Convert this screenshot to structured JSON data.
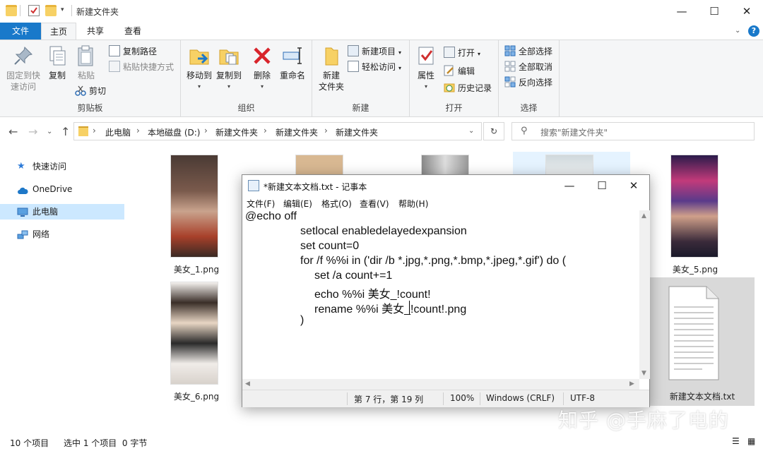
{
  "window": {
    "title": "新建文件夹",
    "minimize": "—",
    "maximize": "☐",
    "close": "✕"
  },
  "ribbon_tabs": [
    "文件",
    "主页",
    "共享",
    "查看"
  ],
  "ribbon": {
    "clipboard": {
      "label": "剪贴板",
      "pin": "固定到快速访问",
      "pin_l1": "固定到快",
      "pin_l2": "速访问",
      "copy": "复制",
      "paste": "粘贴",
      "copy_path": "复制路径",
      "paste_shortcut": "粘贴快捷方式",
      "cut": "剪切"
    },
    "organize": {
      "label": "组织",
      "move_to": "移动到",
      "copy_to": "复制到",
      "delete": "删除",
      "rename": "重命名"
    },
    "new": {
      "label": "新建",
      "new_folder_l1": "新建",
      "new_folder_l2": "文件夹",
      "new_item": "新建项目",
      "easy_access": "轻松访问"
    },
    "open": {
      "label": "打开",
      "properties": "属性",
      "open": "打开",
      "edit": "编辑",
      "history": "历史记录"
    },
    "select": {
      "label": "选择",
      "select_all": "全部选择",
      "select_none": "全部取消",
      "invert": "反向选择"
    }
  },
  "address": {
    "crumbs": [
      "此电脑",
      "本地磁盘 (D:)",
      "新建文件夹",
      "新建文件夹",
      "新建文件夹"
    ],
    "search_placeholder": "搜索\"新建文件夹\""
  },
  "nav": [
    "快速访问",
    "OneDrive",
    "此电脑",
    "网络"
  ],
  "files": {
    "f1": "美女_1.png",
    "f5": "美女_5.png",
    "f6": "美女_6.png",
    "txt": "新建文本文档.txt"
  },
  "status": {
    "count": "10 个项目",
    "selected": "选中 1 个项目  0 字节"
  },
  "notepad": {
    "title": "*新建文本文档.txt - 记事本",
    "menu": [
      "文件(F)",
      "编辑(E)",
      "格式(O)",
      "查看(V)",
      "帮助(H)"
    ],
    "lines": [
      "@echo off",
      "setlocal enabledelayedexpansion",
      "set count=0",
      "for /f %%i in ('dir /b *.jpg,*.png,*.bmp,*.jpeg,*.gif') do (",
      "set /a count+=1",
      "echo %%i 美女_!count!",
      "rename %%i 美女_!count!.png",
      ")"
    ],
    "status": {
      "position": "第 7 行，第 19 列",
      "zoom": "100%",
      "eol": "Windows (CRLF)",
      "encoding": "UTF-8"
    }
  },
  "watermark": "知乎 @手麻了电的",
  "colors": {
    "file_tab": "#1979ca",
    "selected_nav": "#cce8ff",
    "delete_red": "#d8242b",
    "folder_yellow": "#f7d165"
  }
}
